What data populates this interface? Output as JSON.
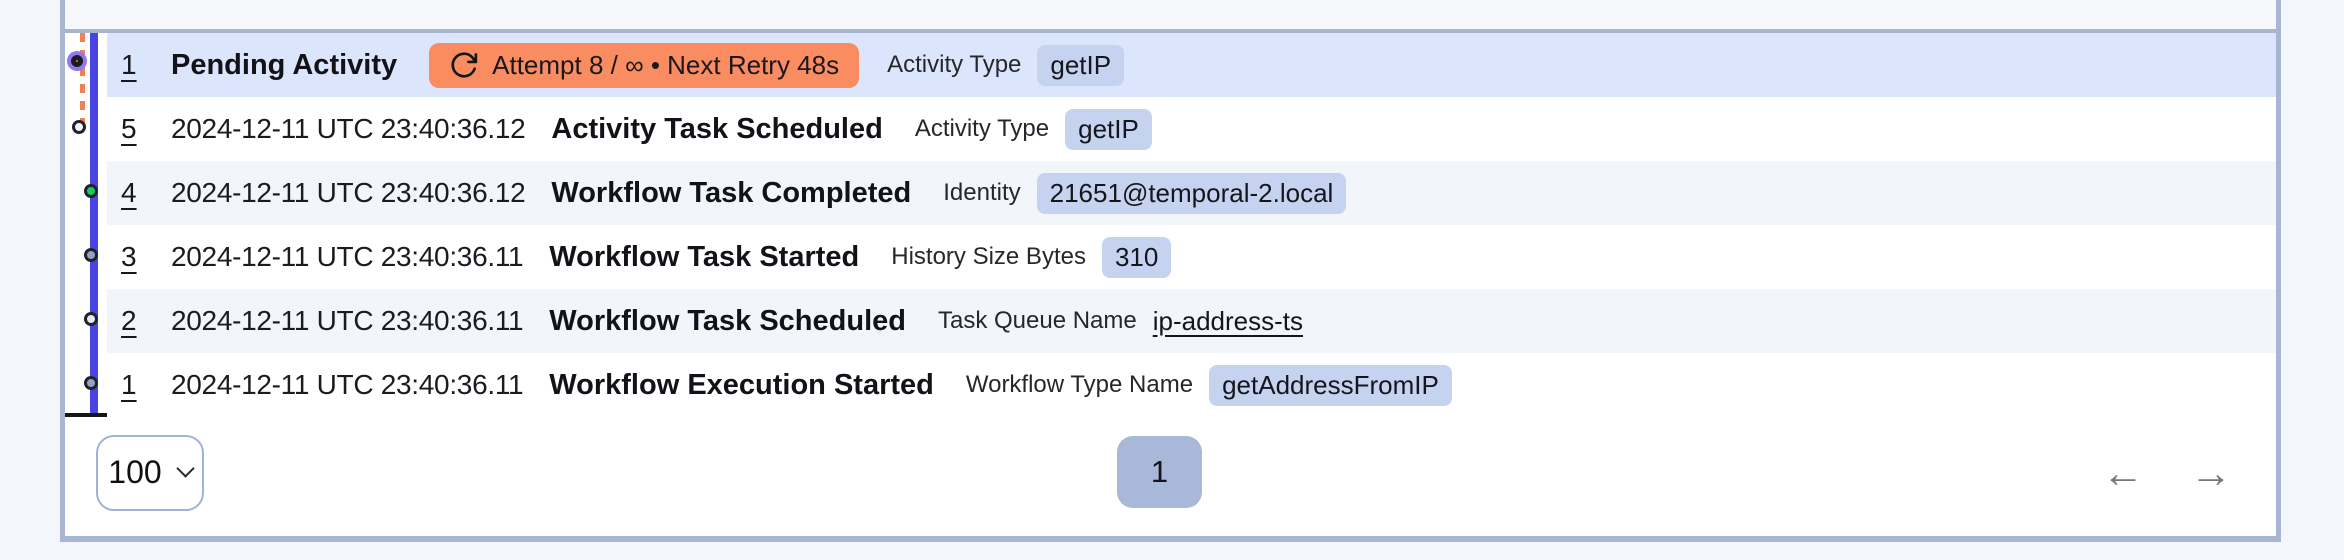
{
  "table": {
    "rows": [
      {
        "id": "1",
        "time": "",
        "name": "Pending Activity",
        "retry_badge": "Attempt 8 / ∞ • Next Retry 48s",
        "attr_label": "Activity Type",
        "attr_value": "getIP"
      },
      {
        "id": "5",
        "time": "2024-12-11 UTC 23:40:36.12",
        "name": "Activity Task Scheduled",
        "attr_label": "Activity Type",
        "attr_value": "getIP"
      },
      {
        "id": "4",
        "time": "2024-12-11 UTC 23:40:36.12",
        "name": "Workflow Task Completed",
        "attr_label": "Identity",
        "attr_value": "21651@temporal-2.local"
      },
      {
        "id": "3",
        "time": "2024-12-11 UTC 23:40:36.11",
        "name": "Workflow Task Started",
        "attr_label": "History Size Bytes",
        "attr_value": "310"
      },
      {
        "id": "2",
        "time": "2024-12-11 UTC 23:40:36.11",
        "name": "Workflow Task Scheduled",
        "attr_label": "Task Queue Name",
        "attr_value": "ip-address-ts"
      },
      {
        "id": "1",
        "time": "2024-12-11 UTC 23:40:36.11",
        "name": "Workflow Execution Started",
        "attr_label": "Workflow Type Name",
        "attr_value": "getAddressFromIP"
      }
    ]
  },
  "pagination": {
    "page_size": "100",
    "current_page": "1",
    "prev_label": "←",
    "next_label": "→"
  },
  "colors": {
    "timeline_line": "#4845e4",
    "retry_connector": "#f08057",
    "pending_badge_bg": "#f98c60",
    "value_badge_bg": "#c5d3f1",
    "selected_row_bg": "#dbe5fb",
    "marker_green": "#17c964",
    "marker_slate": "#90a3c0",
    "panel_border": "#a8b5d3",
    "page_button_bg": "#a9b8d8"
  }
}
